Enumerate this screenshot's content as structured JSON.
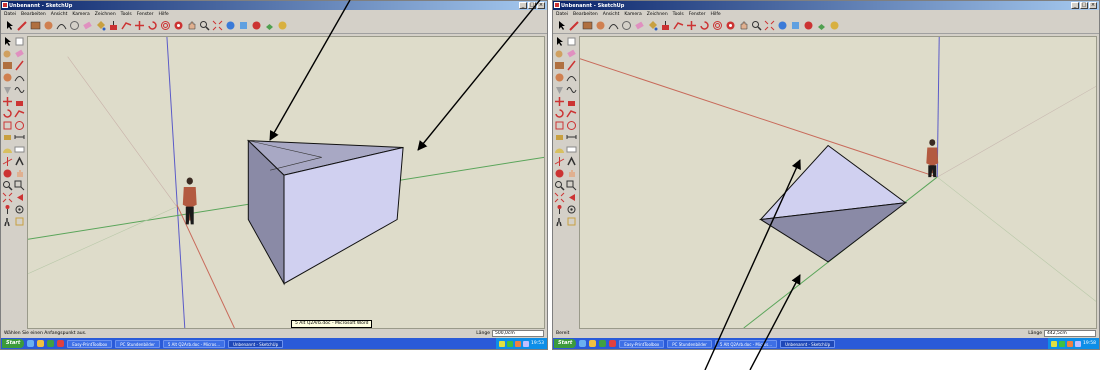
{
  "left_window": {
    "title": "Unbenannt - SketchUp",
    "menu": [
      "Datei",
      "Bearbeiten",
      "Ansicht",
      "Kamera",
      "Zeichnen",
      "Tools",
      "Fenster",
      "Hilfe"
    ],
    "status_text": "Wählen Sie einen Anfangspunkt aus.",
    "measure_label": "Länge",
    "measure_value": "500,0cm",
    "tooltip": "5 Alt Q2Arb.doc - Microsoft Word",
    "taskbar": {
      "start": "Start",
      "tasks": [
        "Easy-PrintToolbox",
        "PC Stundenbilder",
        "5 Alt Q2Arb.doc - Micros...",
        "Unbenannt - SketchUp"
      ],
      "clock": "19:53"
    }
  },
  "right_window": {
    "title": "Unbenannt - SketchUp",
    "menu": [
      "Datei",
      "Bearbeiten",
      "Ansicht",
      "Kamera",
      "Zeichnen",
      "Tools",
      "Fenster",
      "Hilfe"
    ],
    "status_text": "Bereit",
    "measure_label": "Länge",
    "measure_value": "442,5cm",
    "taskbar": {
      "start": "Start",
      "tasks": [
        "Easy-PrintToolbox",
        "PC Stundenbilder",
        "5 Alt Q2Arb.doc - Micros...",
        "Unbenannt - SketchUp"
      ],
      "clock": "19:58"
    }
  },
  "colors": {
    "viewport_bg": "#dedcca",
    "axis_red": "#c86a5a",
    "axis_green": "#5aa55a",
    "axis_blue": "#5a5ac8",
    "face_front": "#d0d0f0",
    "face_shaded": "#8a8aa6",
    "titlebar": "#0a246a",
    "taskbar": "#2a5ad8"
  },
  "icons": [
    "select-icon",
    "pencil-icon",
    "rectangle-icon",
    "circle-icon",
    "arc-icon",
    "eraser-icon",
    "push-pull-icon",
    "move-icon",
    "rotate-icon",
    "orbit-icon",
    "pan-icon",
    "zoom-icon",
    "tape-measure-icon",
    "paint-bucket-icon",
    "walk-icon",
    "position-camera-icon"
  ]
}
